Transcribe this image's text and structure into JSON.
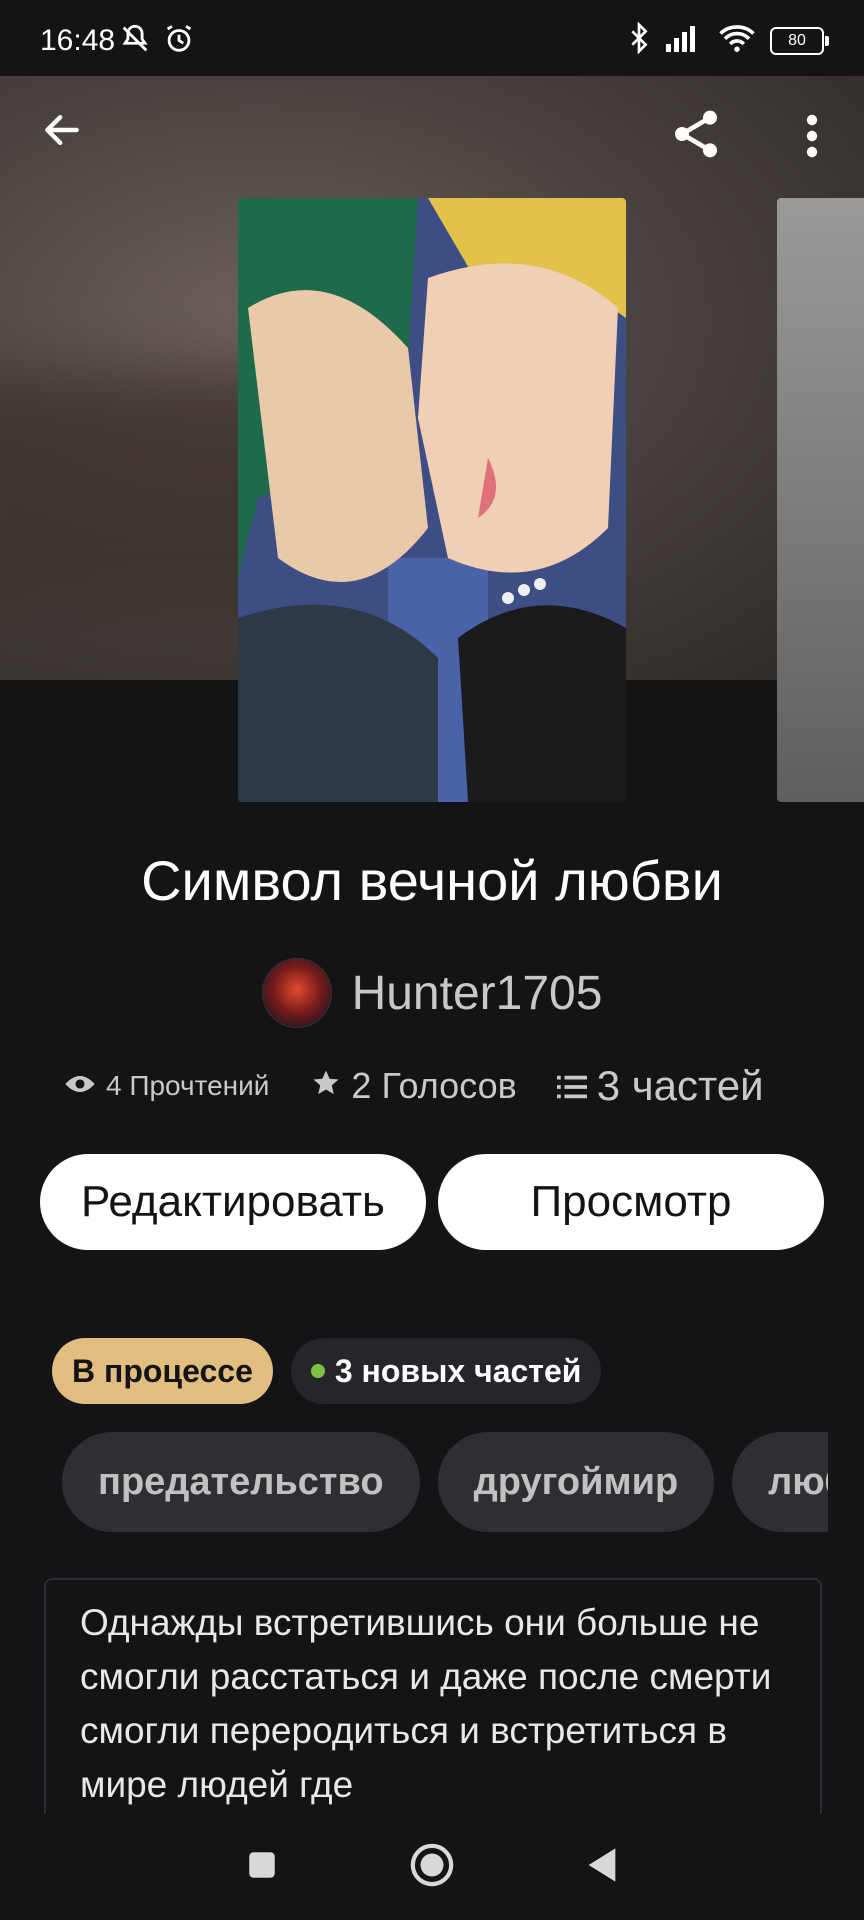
{
  "status_bar": {
    "time": "16:48",
    "battery": "80",
    "icons": [
      "mute-icon",
      "alarm-icon",
      "bluetooth-icon",
      "signal-icon",
      "wifi-icon",
      "battery-icon"
    ]
  },
  "header": {
    "back_icon": "back-arrow-icon",
    "share_icon": "share-icon",
    "menu_icon": "more-vert-icon"
  },
  "story": {
    "title": "Символ вечной любви",
    "author": "Hunter1705",
    "stats": {
      "reads": "4 Прочтений",
      "votes": "2 Голосов",
      "parts": "3 частей"
    }
  },
  "actions": {
    "edit_label": "Редактировать",
    "view_label": "Просмотр"
  },
  "badges": {
    "status": "В процессе",
    "new_parts": "3 новых частей"
  },
  "tags": [
    "предательство",
    "другоймир",
    "любовь"
  ],
  "description": "Однажды встретившись они больше не смогли расстаться и даже после смерти смогли перeродиться и встретиться в мире людей где",
  "colors": {
    "background": "#141316",
    "status_badge": "#e1bd7f",
    "new_dot": "#7cc242",
    "tag_bg": "#2f2f33"
  }
}
